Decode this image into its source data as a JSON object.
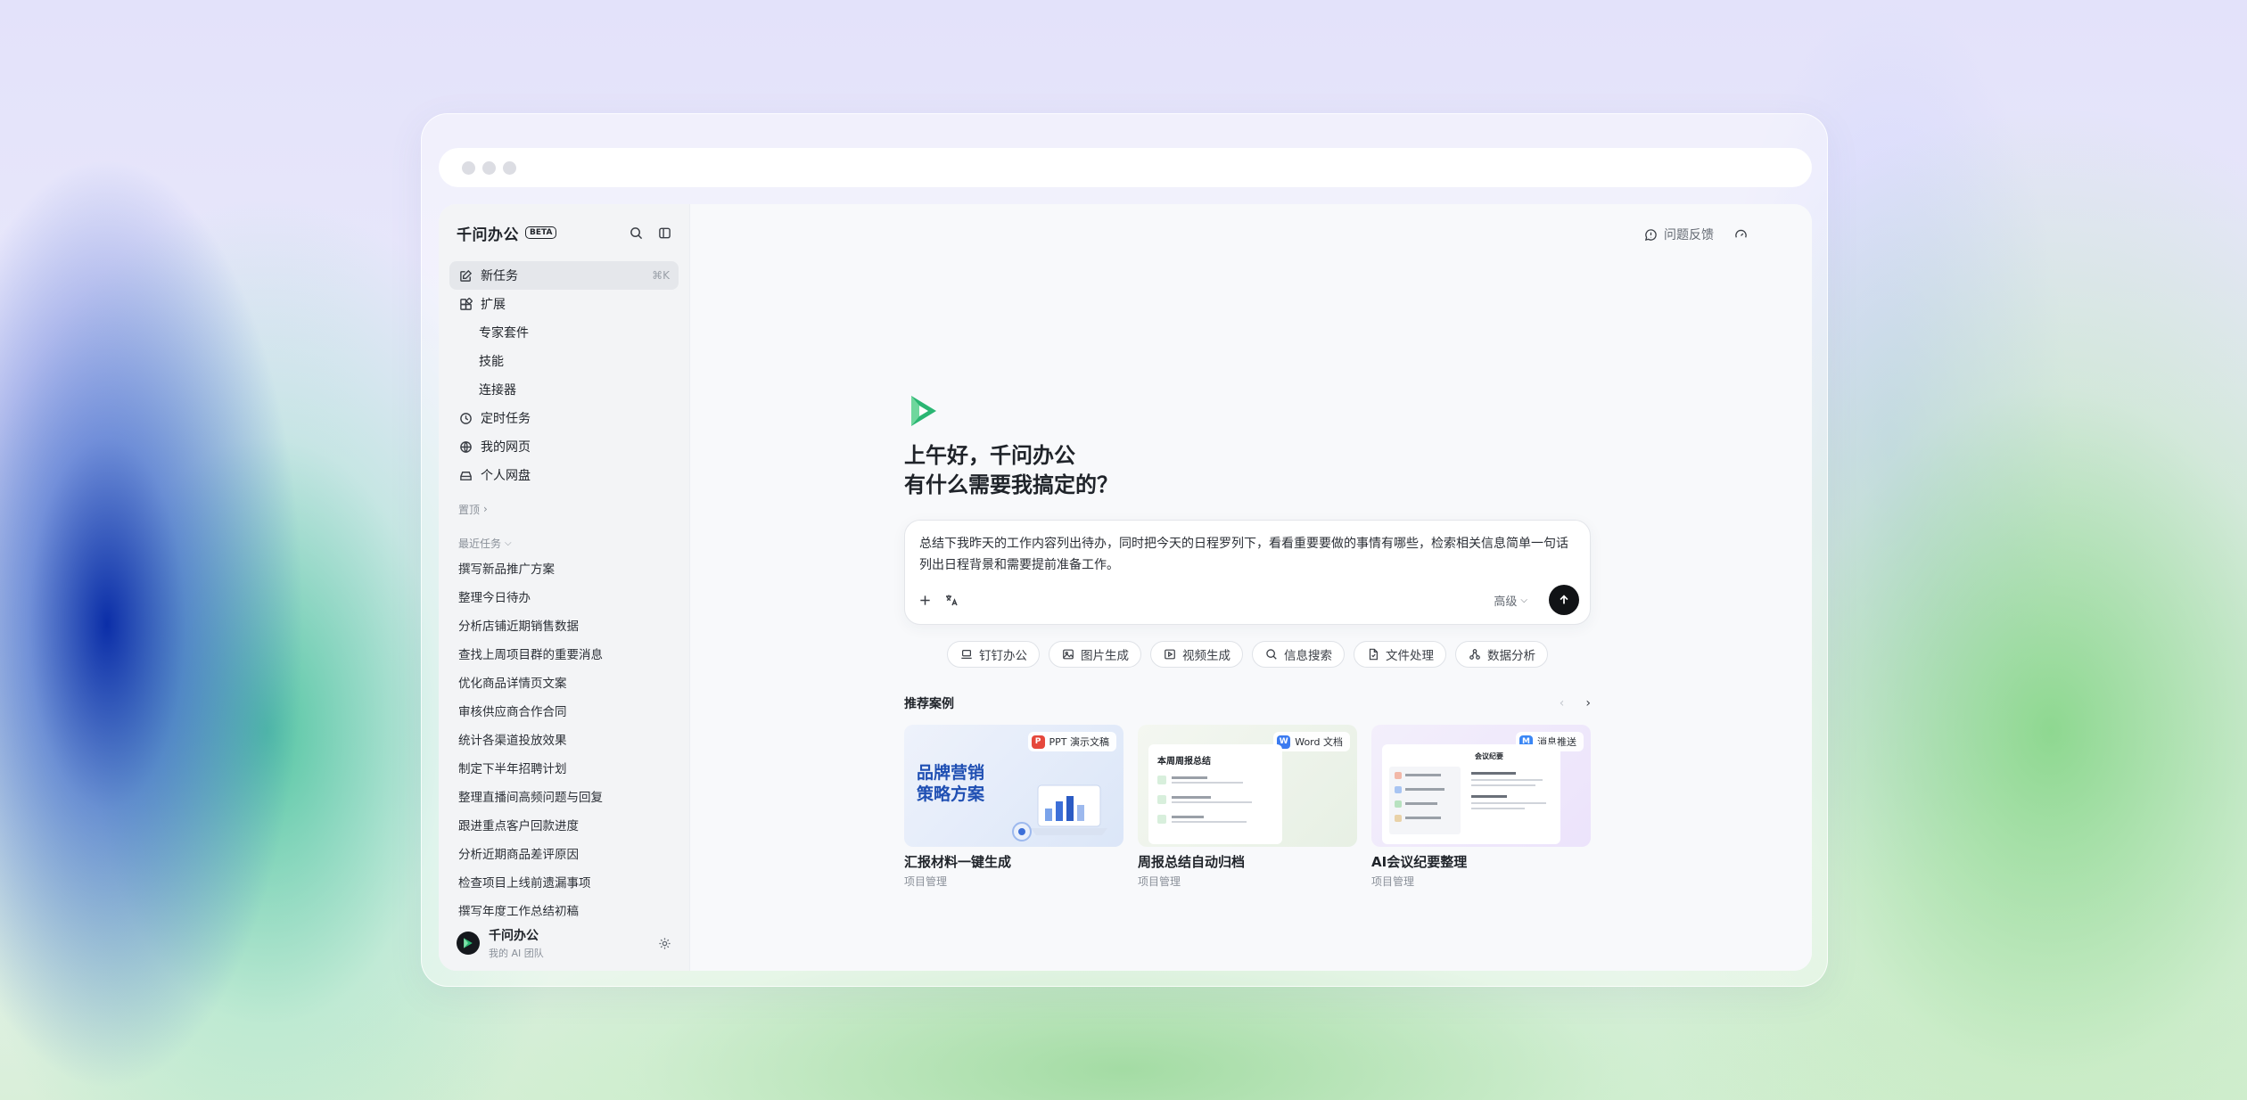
{
  "app": {
    "name": "千问办公",
    "badge": "BETA"
  },
  "sidebar": {
    "new_task": {
      "label": "新任务",
      "shortcut": "⌘K"
    },
    "extensions": {
      "label": "扩展",
      "children": [
        "专家套件",
        "技能",
        "连接器"
      ]
    },
    "scheduled": "定时任务",
    "webpages": "我的网页",
    "drive": "个人网盘",
    "pinned_label": "置顶",
    "recent_label": "最近任务",
    "recent": [
      "撰写新品推广方案",
      "整理今日待办",
      "分析店铺近期销售数据",
      "查找上周项目群的重要消息",
      "优化商品详情页文案",
      "审核供应商合作合同",
      "统计各渠道投放效果",
      "制定下半年招聘计划",
      "整理直播间高频问题与回复",
      "跟进重点客户回款进度",
      "分析近期商品差评原因",
      "检查项目上线前遗漏事项",
      "撰写年度工作总结初稿"
    ],
    "footer": {
      "name": "千问办公",
      "sub": "我的 AI 团队"
    }
  },
  "topbar": {
    "feedback": "问题反馈"
  },
  "hero": {
    "greeting_line1": "上午好，千问办公",
    "greeting_line2": "有什么需要我搞定的？",
    "prompt_text": "总结下我昨天的工作内容列出待办，同时把今天的日程罗列下，看看重要要做的事情有哪些，检索相关信息简单一句话列出日程背景和需要提前准备工作。",
    "advanced_label": "高级"
  },
  "chips": [
    {
      "label": "钉钉办公",
      "icon": "laptop-icon"
    },
    {
      "label": "图片生成",
      "icon": "image-icon"
    },
    {
      "label": "视频生成",
      "icon": "video-icon"
    },
    {
      "label": "信息搜索",
      "icon": "search-icon"
    },
    {
      "label": "文件处理",
      "icon": "file-icon"
    },
    {
      "label": "数据分析",
      "icon": "chart-icon"
    }
  ],
  "recommend": {
    "title": "推荐案例",
    "cards": [
      {
        "tag": "PPT 演示文稿",
        "tag_letter": "P",
        "tag_color": "#e5483c",
        "thumb_text_1": "品牌营销",
        "thumb_text_2": "策略方案",
        "title": "汇报材料一键生成",
        "sub": "项目管理"
      },
      {
        "tag": "Word 文档",
        "tag_letter": "W",
        "tag_color": "#3b7bf0",
        "thumb_text_1": "本周周报总结",
        "title": "周报总结自动归档",
        "sub": "项目管理"
      },
      {
        "tag": "消息推送",
        "tag_letter": "M",
        "tag_color": "#3a86f5",
        "thumb_text_1": "会议纪要",
        "title": "AI会议纪要整理",
        "sub": "项目管理"
      }
    ]
  },
  "colors": {
    "accent_green": "#2bb673",
    "send_button": "#111316"
  }
}
